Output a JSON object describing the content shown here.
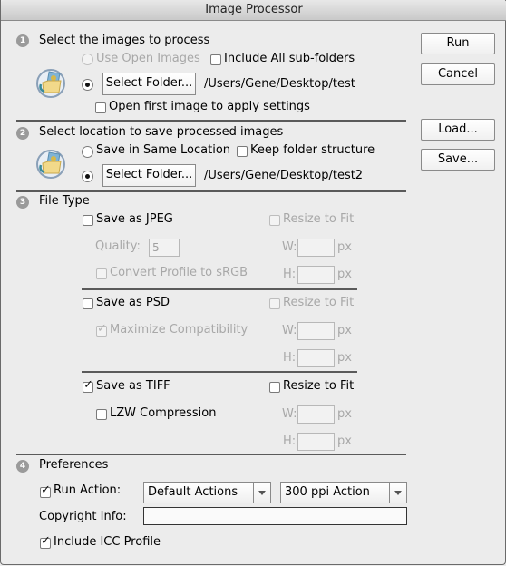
{
  "window": {
    "title": "Image Processor"
  },
  "buttons": {
    "run": "Run",
    "cancel": "Cancel",
    "load": "Load...",
    "save": "Save..."
  },
  "section1": {
    "number": "1",
    "title": "Select the images to process",
    "use_open_images": "Use Open Images",
    "include_subfolders": "Include All sub-folders",
    "select_folder": "Select Folder...",
    "folder_path": "/Users/Gene/Desktop/test",
    "open_first_image": "Open first image to apply settings",
    "icon": "folder-images-icon"
  },
  "section2": {
    "number": "2",
    "title": "Select location to save processed images",
    "save_same_location": "Save in Same Location",
    "keep_folder_structure": "Keep folder structure",
    "select_folder": "Select Folder...",
    "folder_path": "/Users/Gene/Desktop/test2",
    "icon": "folder-images-icon"
  },
  "section3": {
    "number": "3",
    "title": "File Type",
    "jpeg": {
      "label": "Save as JPEG",
      "checked": false,
      "quality_label": "Quality:",
      "quality_value": "5",
      "convert_profile": "Convert Profile to sRGB",
      "resize": "Resize to Fit",
      "w_label": "W:",
      "h_label": "H:",
      "unit": "px"
    },
    "psd": {
      "label": "Save as PSD",
      "checked": false,
      "maximize": "Maximize Compatibility",
      "resize": "Resize to Fit",
      "w_label": "W:",
      "h_label": "H:",
      "unit": "px"
    },
    "tiff": {
      "label": "Save as TIFF",
      "checked": true,
      "lzw": "LZW Compression",
      "resize": "Resize to Fit",
      "w_label": "W:",
      "h_label": "H:",
      "unit": "px"
    }
  },
  "section4": {
    "number": "4",
    "title": "Preferences",
    "run_action": "Run Action:",
    "action_set": "Default Actions",
    "action": "300 ppi Action",
    "copyright_label": "Copyright Info:",
    "copyright_value": "",
    "include_icc": "Include ICC Profile"
  },
  "symbols": {
    "check": "✓"
  }
}
